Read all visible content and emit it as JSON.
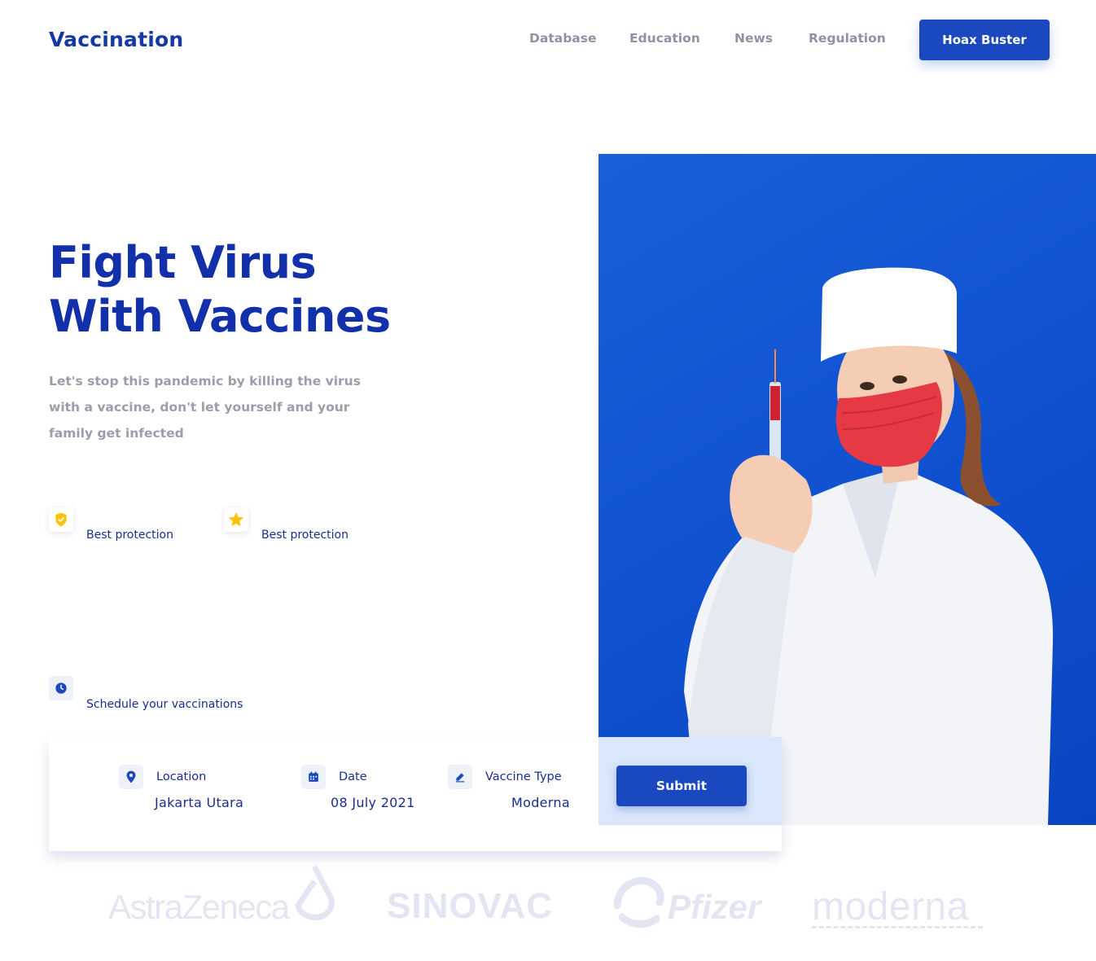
{
  "header": {
    "logo": "Vaccination",
    "nav": [
      "Database",
      "Education",
      "News",
      "Regulation"
    ],
    "cta": "Hoax Buster"
  },
  "hero": {
    "title_line1": "Fight Virus",
    "title_line2": "With Vaccines",
    "subtitle": "Let's stop this pandemic by killing the virus with a vaccine, don't let yourself and your family get infected"
  },
  "features": [
    {
      "icon": "shield-check-icon",
      "label": "Best protection"
    },
    {
      "icon": "star-icon",
      "label": "Best protection"
    }
  ],
  "schedule": {
    "icon": "clock-icon",
    "label": "Schedule your vaccinations"
  },
  "form": {
    "location": {
      "icon": "location-pin-icon",
      "label": "Location",
      "value": "Jakarta Utara"
    },
    "date": {
      "icon": "calendar-icon",
      "label": "Date",
      "value": "08 July 2021"
    },
    "vaccine": {
      "icon": "edit-icon",
      "label": "Vaccine Type",
      "value": "Moderna"
    },
    "submit": "Submit"
  },
  "brands": [
    "AstraZeneca",
    "SINOVAC",
    "Pfizer",
    "moderna"
  ],
  "colors": {
    "primary": "#1a49bf",
    "heading": "#1130a9",
    "muted": "#9a9ea9",
    "star": "#ffc107",
    "image_bg": "#0f50cf"
  }
}
